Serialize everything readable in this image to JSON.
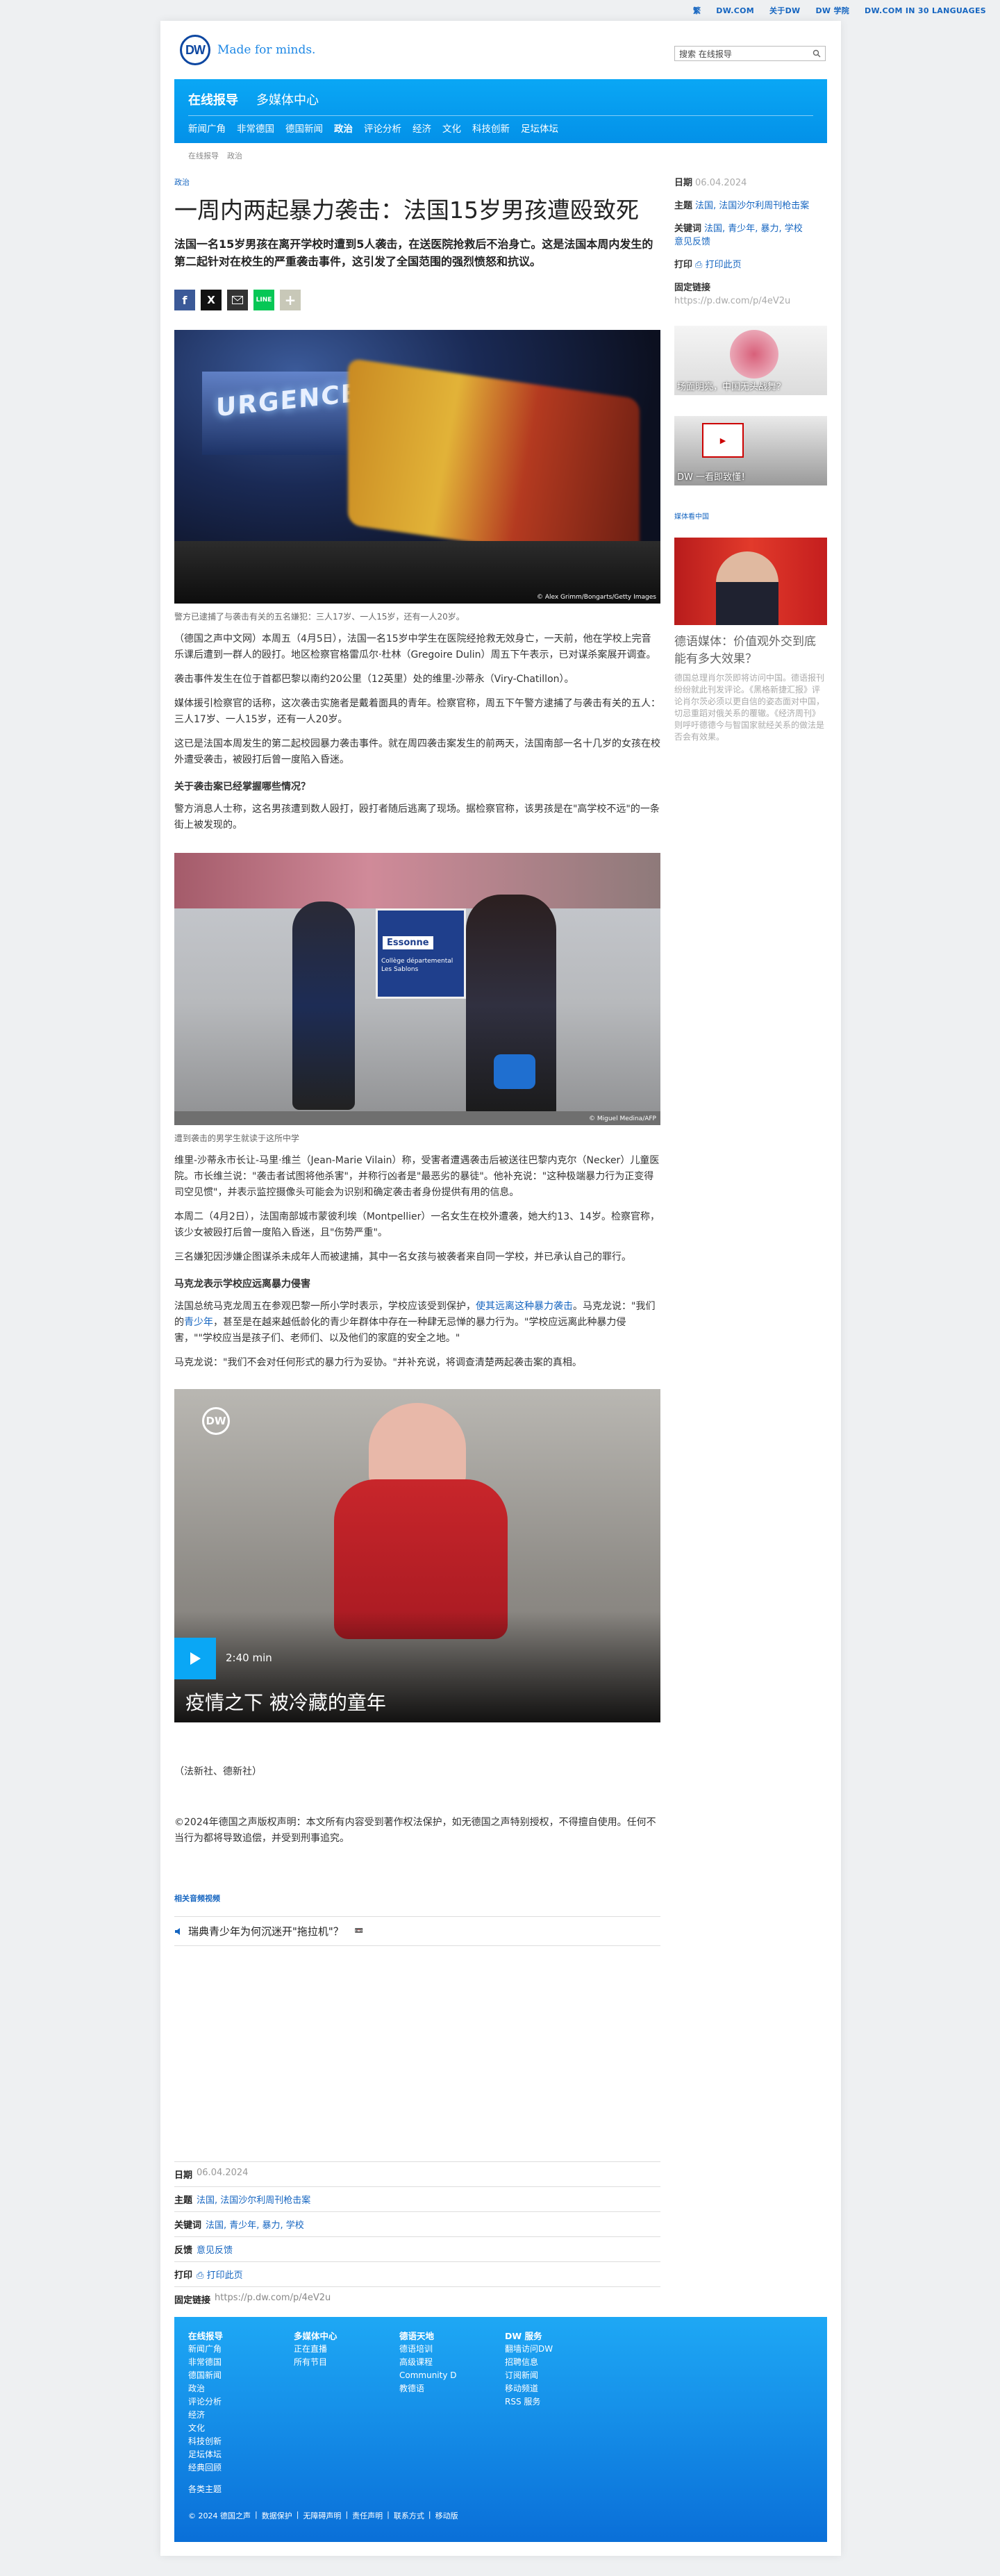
{
  "topbar": {
    "items": [
      "繁",
      "DW.COM",
      "关于DW",
      "DW 学院",
      "DW.COM IN 30 LANGUAGES"
    ]
  },
  "header": {
    "logo": "DW",
    "tagline": "Made for minds.",
    "search_placeholder": "搜索 在线报导"
  },
  "nav": {
    "main": [
      "在线报导",
      "多媒体中心"
    ],
    "sub": [
      "新闻广角",
      "非常德国",
      "德国新闻",
      "政治",
      "评论分析",
      "经济",
      "文化",
      "科技创新",
      "足坛体坛"
    ],
    "active": "政治"
  },
  "breadcrumb": [
    "在线报导",
    "政治"
  ],
  "article": {
    "kicker": "政治",
    "title": "一周内两起暴力袭击：法国15岁男孩遭殴致死",
    "lead": "法国一名15岁男孩在离开学校时遭到5人袭击，在送医院抢救后不治身亡。这是法国本周内发生的第二起针对在校生的严重袭击事件，这引发了全国范围的强烈愤怒和抗议。",
    "image1": {
      "text": "URGENCES",
      "credit": "© Alex Grimm/Bongarts/Getty Images",
      "caption": "警方已逮捕了与袭击有关的五名嫌犯：三人17岁、一人15岁，还有一人20岁。"
    },
    "p1": "（德国之声中文网）本周五（4月5日），法国一名15岁中学生在医院经抢救无效身亡，一天前，他在学校上完音乐课后遭到一群人的殴打。地区检察官格雷瓜尔·杜林（Gregoire Dulin）周五下午表示，已对谋杀案展开调查。",
    "p2": "袭击事件发生在位于首都巴黎以南约20公里（12英里）处的维里-沙蒂永（Viry-Chatillon）。",
    "p3": "媒体援引检察官的话称，这次袭击实施者是戴着面具的青年。检察官称，周五下午警方逮捕了与袭击有关的五人：三人17岁、一人15岁，还有一人20岁。",
    "p4": "这已是法国本周发生的第二起校园暴力袭击事件。就在周四袭击案发生的前两天，法国南部一名十几岁的女孩在校外遭受袭击，被殴打后曾一度陷入昏迷。",
    "sub1": "关于袭击案已经掌握哪些情况？",
    "p5": "警方消息人士称，这名男孩遭到数人殴打，殴打者随后逃离了现场。据检察官称，该男孩是在\"高学校不远\"的一条街上被发现的。",
    "image2": {
      "sign": "Essonne",
      "sign_line": "Collège départemental Les Sablons",
      "credit": "© Miguel Medina/AFP",
      "caption": "遭到袭击的男学生就读于这所中学"
    },
    "p6": "维里-沙蒂永市长让-马里·维兰（Jean-Marie Vilain）称，受害者遭遇袭击后被送往巴黎内克尔（Necker）儿童医院。市长维兰说：\"袭击者试图将他杀害\"，并称行凶者是\"最恶劣的暴徒\"。他补充说：\"这种极端暴力行为正变得司空见惯\"，并表示监控摄像头可能会为识别和确定袭击者身份提供有用的信息。",
    "p7": "本周二（4月2日），法国南部城市蒙彼利埃（Montpellier）一名女生在校外遭袭，她大约13、14岁。检察官称，该少女被殴打后曾一度陷入昏迷，且\"伤势严重\"。",
    "p8": "三名嫌犯因涉嫌企图谋杀未成年人而被逮捕，其中一名女孩与被袭者来自同一学校，并已承认自己的罪行。",
    "sub2": "马克龙表示学校应远离暴力侵害",
    "p9_a": "法国总统马克龙周五在参观巴黎一所小学时表示，学校应该受到保护，",
    "p9_link": "使其远离这种暴力袭击",
    "p9_b": "。马克龙说：\"我们的",
    "p9_link2": "青少年",
    "p9_c": "，甚至是在越来越低龄化的青少年群体中存在一种肆无忌惮的暴力行为。\"学校应远离此种暴力侵害，\"\"学校应当是孩子们、老师们、以及他们的家庭的安全之地。\"",
    "p10": "马克龙说：\"我们不会对任何形式的暴力行为妥协。\"并补充说，将调查清楚两起袭击案的真相。",
    "video": {
      "duration": "2:40 min",
      "title": "疫情之下 被冷藏的童年",
      "logo": "DW"
    },
    "source": "（法新社、德新社）",
    "copyright": "©2024年德国之声版权声明：本文所有内容受到著作权法保护，如无德国之声特别授权，不得擅自使用。任何不当行为都将导致追偿，并受到刑事追究。",
    "related_label": "相关音频视频",
    "related_item": "瑞典青少年为何沉迷开\"拖拉机\"？",
    "related_icon_label": "📼"
  },
  "meta": {
    "date_label": "日期",
    "date": "06.04.2024",
    "topic_label": "主题",
    "topic": "法国, 法国沙尔利周刊枪击案",
    "keywords_label": "关键词",
    "keywords": "法国, 青少年, 暴力, 学校",
    "feedback_label": "反馈",
    "feedback": "意见反馈",
    "print_label": "打印",
    "print": "打印此页",
    "link_label": "固定链接",
    "link": "https://p.dw.com/p/4eV2u"
  },
  "sidebar": {
    "date_label": "日期",
    "date": "06.04.2024",
    "topic_label": "主题",
    "topic": "法国, 法国沙尔利周刊枪击案",
    "keywords_label": "关键词",
    "keywords": "法国, 青少年, 暴力, 学校",
    "feedback": "意见反馈",
    "print_label": "打印",
    "print": "打印此页",
    "link_label": "固定链接",
    "link": "https://p.dw.com/p/4eV2u",
    "promo1": "场面明亮，中国无头战舞？",
    "promo2": "DW 一看即致懂！",
    "section": "媒体看中国",
    "story_title": "德语媒体：价值观外交到底能有多大效果？",
    "story_text": "德国总理肖尔茨即将访问中国。德语报刊纷纷就此刊发评论。《黑格新捷汇报》评论肖尔茨必须以更自信的姿态面对中国，切忌重蹈对俄关系的覆辙。《经济周刊》则呼吁德德今与智国家就经关系的做法是否会有效果。"
  },
  "footer": {
    "col1": {
      "head": "在线报导",
      "items": [
        "新闻广角",
        "非常德国",
        "德国新闻",
        "政治",
        "评论分析",
        "经济",
        "文化",
        "科技创新",
        "足坛体坛",
        "经典回顾"
      ],
      "extra": "各类主题"
    },
    "col2": {
      "head": "多媒体中心",
      "items": [
        "正在直播",
        "所有节目"
      ]
    },
    "col3": {
      "head": "德语天地",
      "items": [
        "德语培训",
        "高级课程",
        "Community D",
        "教德语"
      ]
    },
    "col4": {
      "head": "DW 服务",
      "items": [
        "翻墙访问DW",
        "招聘信息",
        "订阅新闻",
        "移动频道",
        "RSS 服务"
      ]
    },
    "bottom": [
      "© 2024 德国之声",
      "数据保护",
      "无障碍声明",
      "责任声明",
      "联系方式",
      "移动版"
    ]
  },
  "colors": {
    "accent": "#0aa7f5",
    "link": "#1565c0"
  }
}
